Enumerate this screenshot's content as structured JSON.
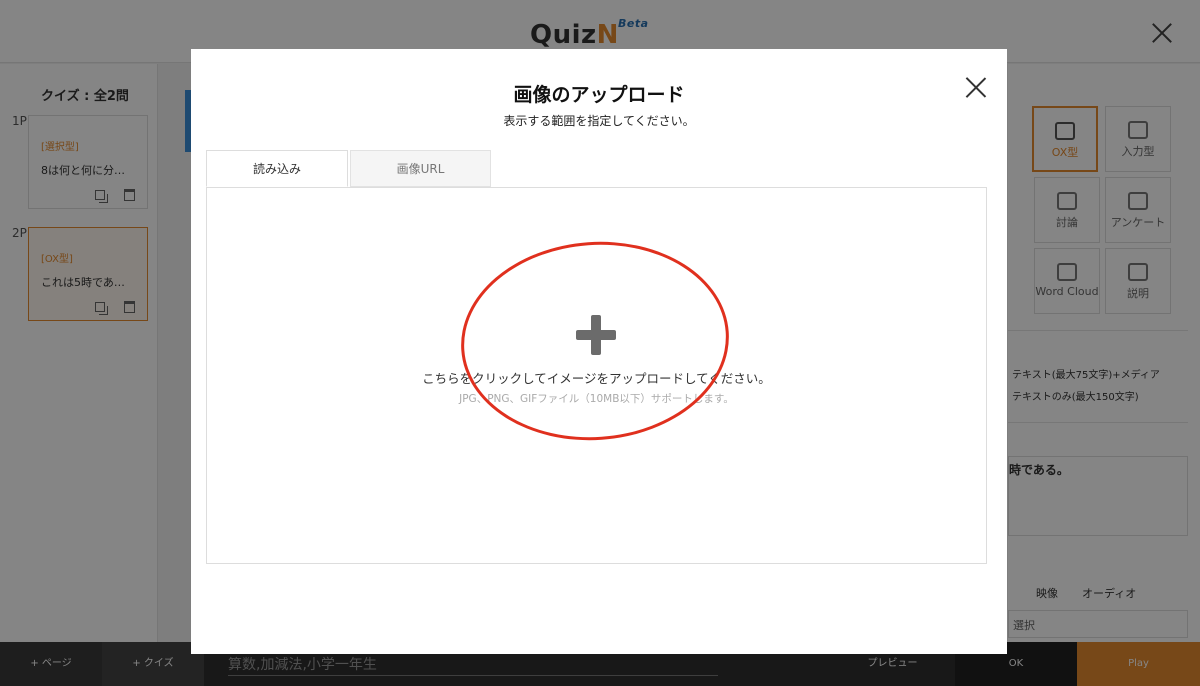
{
  "app": {
    "logo_text": "Quiz",
    "logo_mark": "N",
    "logo_badge": "Beta"
  },
  "sidebar": {
    "quiz_count": "クイズ : 全2問",
    "pages": [
      {
        "page_label": "1P",
        "type_tag": "[選択型]",
        "question": "8は何と何に分…"
      },
      {
        "page_label": "2P",
        "type_tag": "[OX型]",
        "question": "これは5時であ…"
      }
    ]
  },
  "right_panel": {
    "types": [
      {
        "label": "OX型",
        "icon": "ox-icon"
      },
      {
        "label": "入力型",
        "icon": "input-icon"
      },
      {
        "label": "討論",
        "icon": "discussion-icon"
      },
      {
        "label": "アンケート",
        "icon": "pencil-icon"
      },
      {
        "label": "Word Cloud",
        "icon": "cloud-icon"
      },
      {
        "label": "説明",
        "icon": "document-icon"
      }
    ],
    "option_text_media": "テキスト(最大75文字)+メディア",
    "option_text_only": "テキストのみ(最大150文字)",
    "question_text": "時である。",
    "media_video": "映像",
    "media_audio": "オーディオ",
    "select_label": "選択"
  },
  "bottombar": {
    "add_page": "+ ページ",
    "add_quiz": "+ クイズ",
    "tags_value": "算数,加減法,小学一年生",
    "preview": "プレビュー",
    "ok": "OK",
    "play": "Play"
  },
  "modal": {
    "title": "画像のアップロード",
    "subtitle": "表示する範囲を指定してください。",
    "tabs": [
      {
        "label": "読み込み",
        "active": true
      },
      {
        "label": "画像URL",
        "active": false
      }
    ],
    "upload_message": "こちらをクリックしてイメージをアップロードしてください。",
    "upload_hint": "JPG、PNG、GIFファイル（10MB以下）サポートします。"
  },
  "colors": {
    "accent_orange": "#e58a2e",
    "annotation_red": "#e0301e",
    "selection_blue": "#3a8fd8"
  }
}
